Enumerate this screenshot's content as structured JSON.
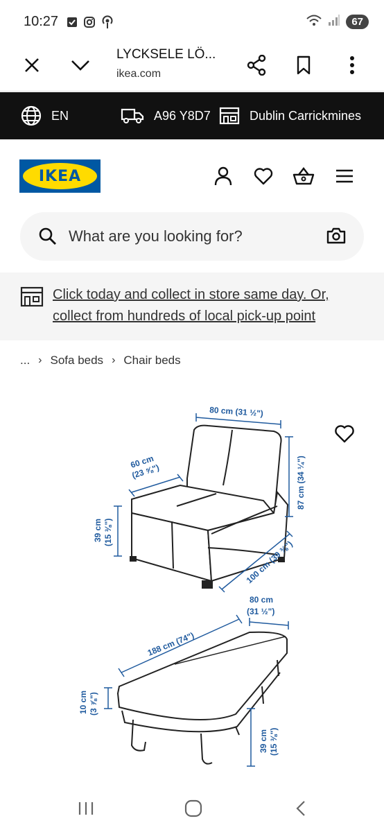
{
  "status_bar": {
    "time": "10:27",
    "left_icons": [
      "checkbox-icon",
      "instagram-icon",
      "podcast-icon"
    ],
    "right_icons": [
      "wifi-icon",
      "signal-icon"
    ],
    "battery": "67"
  },
  "browser": {
    "page_title": "LYCKSELE LÖ...",
    "domain": "ikea.com",
    "buttons": [
      "close",
      "collapse",
      "share",
      "bookmark",
      "more"
    ]
  },
  "locale_bar": {
    "language": "EN",
    "postcode": "A96 Y8D7",
    "store": "Dublin Carrickmines"
  },
  "header": {
    "logo_text": "IKEA",
    "icons": [
      "account-icon",
      "wishlist-heart-icon",
      "shopping-basket-icon",
      "menu-icon"
    ]
  },
  "search": {
    "placeholder": "What are you looking for?"
  },
  "promo": {
    "text": "Click today and collect in store same day. Or, collect from hundreds of local pick-up point"
  },
  "breadcrumb": {
    "ellipsis": "...",
    "items": [
      "Sofa beds",
      "Chair beds"
    ]
  },
  "product_image": {
    "dimensions": {
      "chair_width": "80 cm (31 ½\")",
      "chair_seat_depth": "60 cm",
      "chair_seat_depth_in": "(23 ⅝\")",
      "chair_height": "87 cm (34 ¼\")",
      "chair_seat_height": "39 cm",
      "chair_seat_height_in": "(15 ⅜\")",
      "chair_depth": "100 cm (39 ⅜\")",
      "bed_width": "80 cm",
      "bed_width_in": "(31 ½\")",
      "bed_length": "188 cm (74\")",
      "mattress_thickness": "10 cm",
      "mattress_thickness_in": "(3 ⅞\")",
      "bed_height": "39 cm",
      "bed_height_in": "(15 ⅜\")"
    }
  },
  "colors": {
    "ikea_blue": "#0058a3",
    "ikea_yellow": "#ffdb00",
    "dimension_blue": "#1f5a9e",
    "locale_bar_bg": "#111111"
  }
}
